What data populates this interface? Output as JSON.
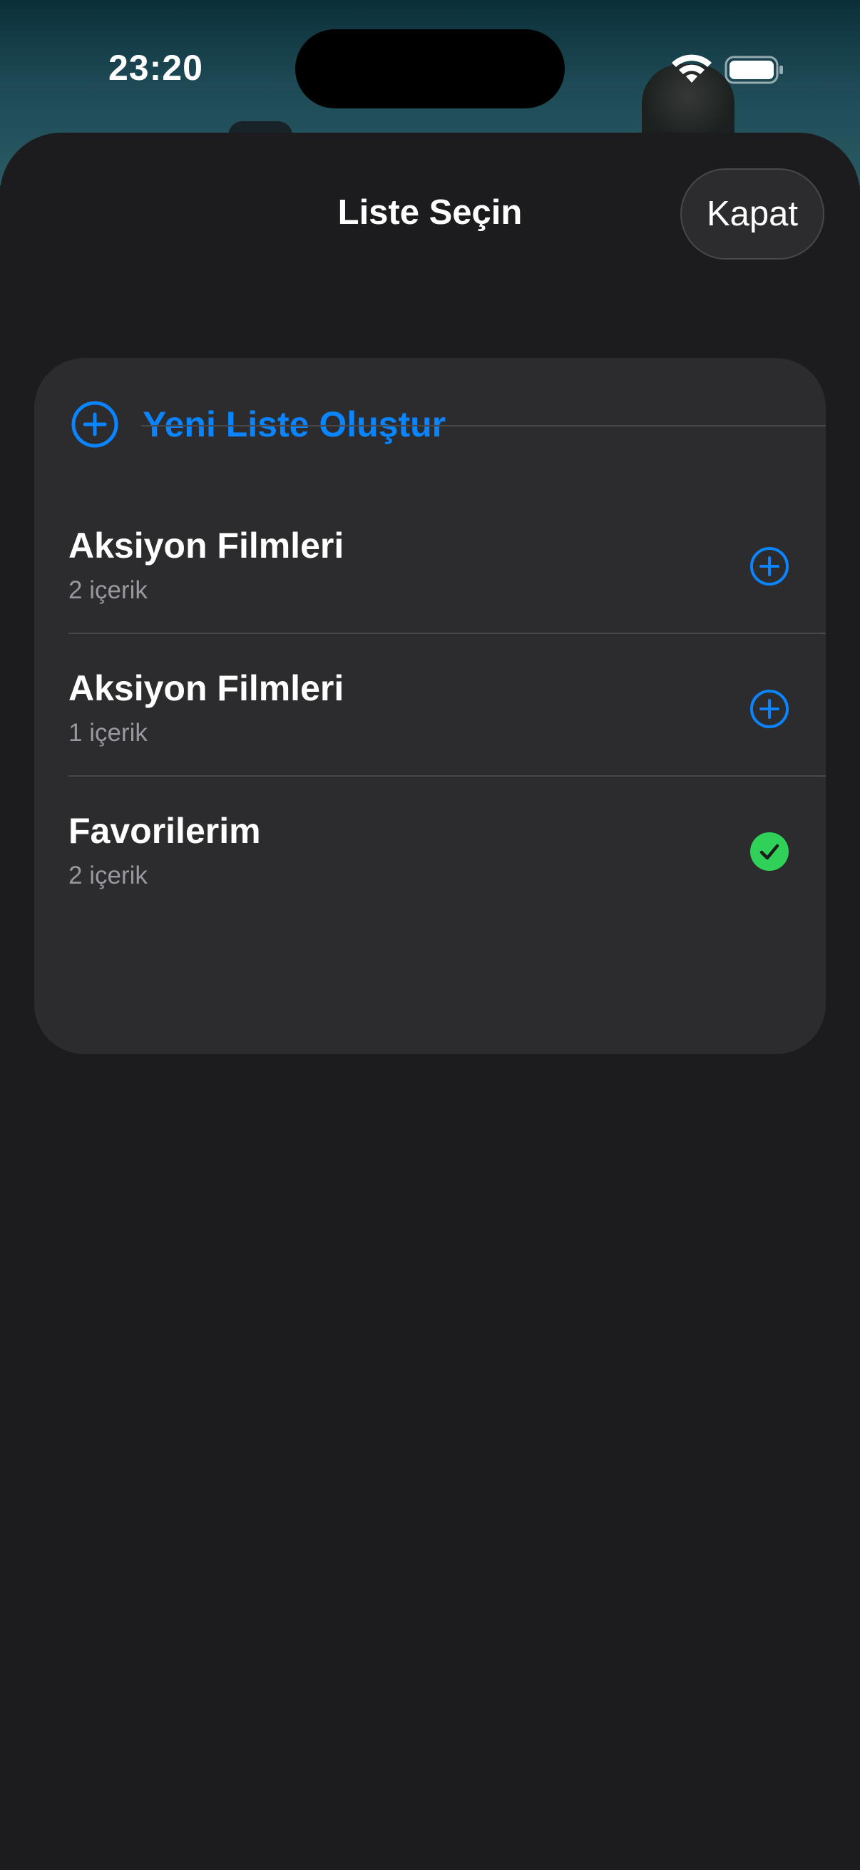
{
  "status_bar": {
    "time": "23:20"
  },
  "sheet": {
    "title": "Liste Seçin",
    "close_label": "Kapat"
  },
  "new_list": {
    "label": "Yeni Liste Oluştur",
    "icon": "plus-circle-icon"
  },
  "lists": [
    {
      "title": "Aksiyon Filmleri",
      "subtitle": "2 içerik",
      "state": "add",
      "icon": "plus-circle-icon"
    },
    {
      "title": "Aksiyon Filmleri",
      "subtitle": "1 içerik",
      "state": "add",
      "icon": "plus-circle-icon"
    },
    {
      "title": "Favorilerim",
      "subtitle": "2 içerik",
      "state": "added",
      "icon": "checkmark-circle-icon"
    }
  ],
  "colors": {
    "accent": "#0a84ff",
    "success": "#30d158",
    "sheet_background": "#1c1c1e",
    "card_background": "#2c2c2e",
    "secondary_text": "#98989f"
  }
}
